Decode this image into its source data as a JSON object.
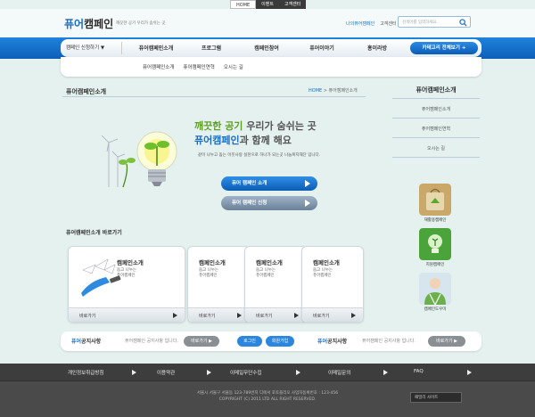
{
  "top_links": [
    "HOME",
    "이벤트",
    "고객센터"
  ],
  "header": {
    "logo_a": "퓨어",
    "logo_b": "캠페인",
    "tagline": "깨끗한 공기 우리가 숨쉬는 곳",
    "link_login": "나의퓨어캠페인",
    "link_cs": "고객센터",
    "search_placeholder": "검색어를 입력하세요."
  },
  "nav": {
    "category_select": "캠페인 신청하기 ▼",
    "items": [
      "퓨어캠페인소개",
      "프로그램",
      "캠페인참여",
      "퓨어이야기",
      "홍이라방"
    ],
    "all_button": "카테고리 전체보기 +",
    "sub_items": [
      "퓨어캠페인소개",
      "퓨어캠페인연혁",
      "오시는 길"
    ]
  },
  "main": {
    "title": "퓨어캠페인소개",
    "breadcrumb_home": "HOME",
    "breadcrumb_current": "퓨어캠페인소개",
    "headline_line1_a": "깨끗한 공기",
    "headline_line1_b": "우리가 숨쉬는 곳",
    "headline_line2_a": "퓨어캠페인",
    "headline_line2_b": "과 함께 해요",
    "description": "같이 나누고 돕는 이웃사랑 실천으로 하나가 되는곳 나눔복지재단 입니다.",
    "btn_intro": "퓨어 캠페인 소개",
    "btn_apply": "퓨어 캠페인 신청",
    "shortcut_title": "퓨어캠페인소개 바로가기",
    "cards": [
      {
        "title": "캠페인소개",
        "desc1": "돕고 나누는",
        "desc2": "퓨어캠페인",
        "more": "바로가기"
      },
      {
        "title": "캠페인소개",
        "desc1": "돕고 나누는",
        "desc2": "퓨어캠페인",
        "more": "바로가기"
      },
      {
        "title": "캠페인소개",
        "desc1": "돕고 나누는",
        "desc2": "퓨어캠페인",
        "more": "바로가기"
      },
      {
        "title": "캠페인소개",
        "desc1": "돕고 나누는",
        "desc2": "퓨어캠페인",
        "more": "바로가기"
      }
    ]
  },
  "sidebar": {
    "title": "퓨어캠페인소개",
    "items": [
      "퓨어캠페인소개",
      "퓨어캠페인연혁",
      "오시는 길"
    ],
    "badges": [
      "재활용캠페인",
      "지원캠페인",
      "캠페인도우미"
    ]
  },
  "bottom": {
    "notice_a": "퓨어",
    "notice_b": "공지사항",
    "notice_text": "퓨어캠페인 공지사항 입니다.",
    "more": "바로가기 ▶",
    "login": "로그인",
    "join": "회원가입",
    "notice2_a": "퓨어",
    "notice2_b": "공지사항",
    "notice2_text": "퓨어캠페인 공지사항 입니다.",
    "more2": "바로가기 ▶"
  },
  "footer": {
    "links": [
      "개인정보취급방침",
      "이용약관",
      "이메일무단수집",
      "이메일문의",
      "FAQ"
    ],
    "address": "서울시 서울구 서울동 123-789번지 디에서 포토플리오 사업자등록번호 : 123-456",
    "copyright": "COPYRIGHT (C) 2011 LTD ALL RIGHT RESERVED.",
    "family_site": "패밀리 사이트"
  }
}
